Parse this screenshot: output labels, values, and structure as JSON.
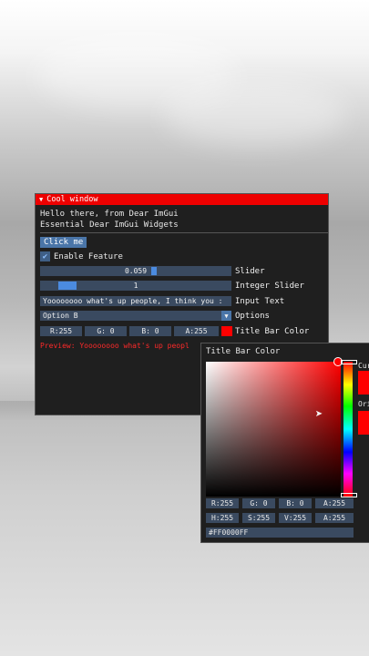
{
  "window": {
    "title": "Cool window",
    "line1": "Hello there, from Dear ImGui",
    "line2": "Essential Dear ImGui Widgets",
    "click_label": "Click me",
    "checkbox_label": "Enable Feature",
    "checkbox_checked": true,
    "slider_value": "0.059",
    "slider_label": "Slider",
    "int_slider_value": "1",
    "int_slider_label": "Integer Slider",
    "input_text": "Yoooooooo what's up people, I think you :",
    "input_label": "Input Text",
    "combo_value": "Option B",
    "combo_label": "Options",
    "color_r": "R:255",
    "color_g": "G:  0",
    "color_b": "B:  0",
    "color_a": "A:255",
    "color_label": "Title Bar Color",
    "preview": "Preview: Yoooooooo what's up peopl",
    "accent": "#ee0000"
  },
  "picker": {
    "title": "Title Bar Color",
    "current_label": "Cur",
    "original_label": "Ori",
    "r": "R:255",
    "g": "G:  0",
    "b": "B:  0",
    "a": "A:255",
    "h": "H:255",
    "s": "S:255",
    "v": "V:255",
    "a2": "A:255",
    "hex": "#FF0000FF"
  }
}
